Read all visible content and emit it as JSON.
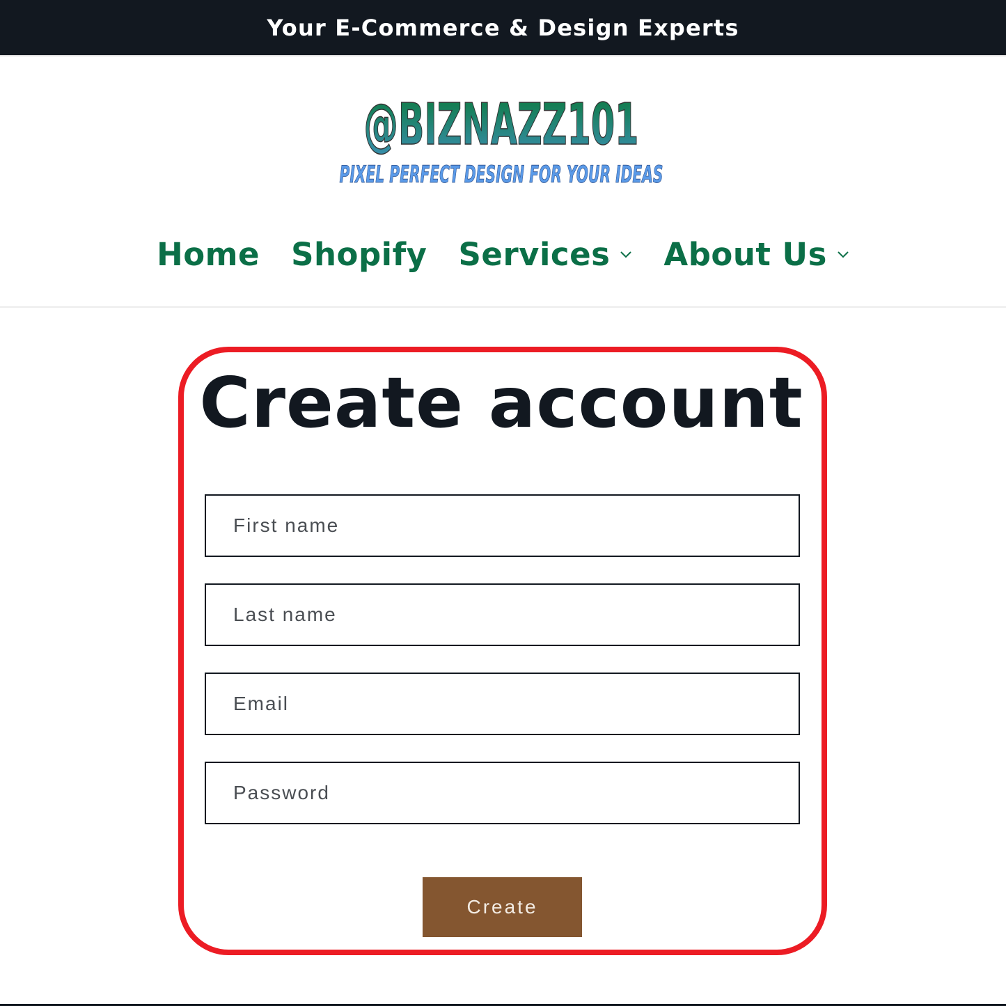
{
  "announcement": {
    "text": "Your E-Commerce & Design Experts"
  },
  "logo": {
    "title": "@BIZNAZZ101",
    "tagline": "PIXEL PERFECT DESIGN FOR YOUR IDEAS",
    "title_gradient": [
      "#0c7a3e",
      "#3a8fb0"
    ],
    "tagline_color": "#5a9ae8"
  },
  "nav": {
    "items": [
      {
        "label": "Home",
        "has_dropdown": false
      },
      {
        "label": "Shopify",
        "has_dropdown": false
      },
      {
        "label": "Services",
        "has_dropdown": true
      },
      {
        "label": "About Us",
        "has_dropdown": true
      }
    ],
    "color": "#0b6f47"
  },
  "form": {
    "title": "Create account",
    "fields": [
      {
        "name": "first_name",
        "placeholder": "First name",
        "value": ""
      },
      {
        "name": "last_name",
        "placeholder": "Last name",
        "value": ""
      },
      {
        "name": "email",
        "placeholder": "Email",
        "value": ""
      },
      {
        "name": "password",
        "placeholder": "Password",
        "value": ""
      }
    ],
    "submit_label": "Create",
    "highlight_color": "#ec1c24",
    "button_color": "#845630"
  }
}
